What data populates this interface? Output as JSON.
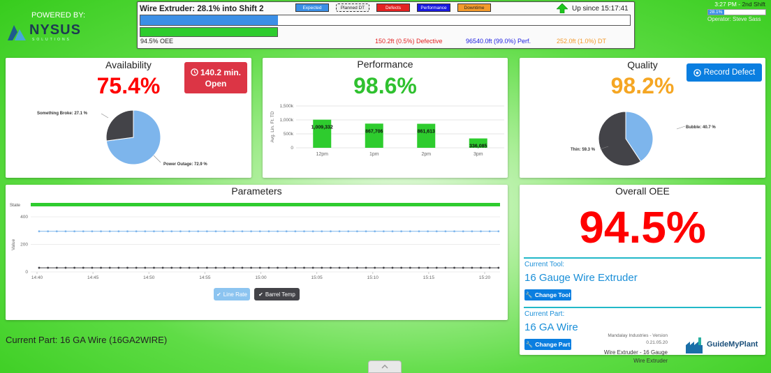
{
  "brand": {
    "powered_by": "POWERED BY:",
    "name": "NYSUS",
    "sub": "SOLUTIONS"
  },
  "header": {
    "title": "Wire Extruder: 28.1% into Shift 2",
    "legend": [
      {
        "label": "Expected",
        "bg": "#3b8fe6",
        "fg": "#ffffff"
      },
      {
        "label": "Planned DT",
        "bg": "#f0f0f0",
        "fg": "#222222"
      },
      {
        "label": "Defects",
        "bg": "#e32222",
        "fg": "#ffffff"
      },
      {
        "label": "Performance",
        "bg": "#1a1ae0",
        "fg": "#ffffff"
      },
      {
        "label": "Downtime",
        "bg": "#f39a2c",
        "fg": "#222222"
      }
    ],
    "uptime": "Up since 15:17:41",
    "expected_fraction": 0.281,
    "oee_fraction": 0.281,
    "oee_text": "94.5% OEE",
    "defective_text": "150.2ft (0.5%) Defective",
    "perf_text": "96540.0ft (99.0%) Perf.",
    "dt_text": "252.0ft (1.0%) DT"
  },
  "topright": {
    "time": "3:27 PM",
    "shift": "2nd Shift",
    "progress_text": "28.1%",
    "progress_fraction": 0.281,
    "operator": "Operator: Steve Sass"
  },
  "availability": {
    "title": "Availability",
    "value": "75.4%",
    "open_time": "140.2 min.",
    "open_label": "Open",
    "slices": [
      {
        "label": "Power Outage: 72.9 %",
        "value": 72.9,
        "color": "#7db5ec"
      },
      {
        "label": "Something Broke: 27.1 %",
        "value": 27.1,
        "color": "#434348"
      }
    ]
  },
  "performance": {
    "title": "Performance",
    "value": "98.6%",
    "chart_data": {
      "type": "bar",
      "categories": [
        "12pm",
        "1pm",
        "2pm",
        "3pm"
      ],
      "values": [
        1009332,
        867706,
        861613,
        336085
      ],
      "value_labels": [
        "1,009,332",
        "867,706",
        "861,613",
        "336,085"
      ],
      "ylabel": "Avg. Lin. Ft. TD",
      "yticks": [
        "0",
        "500k",
        "1,000k",
        "1,500k"
      ],
      "ylim": [
        0,
        1500000
      ],
      "color": "#2ecc2e"
    }
  },
  "quality": {
    "title": "Quality",
    "value": "98.2%",
    "record_label": "Record Defect",
    "slices": [
      {
        "label": "Bubble: 40.7 %",
        "value": 40.7,
        "color": "#7db5ec"
      },
      {
        "label": "Thin: 59.3 %",
        "value": 59.3,
        "color": "#434348"
      }
    ]
  },
  "parameters": {
    "title": "Parameters",
    "state_label": "State",
    "chart_data": {
      "type": "line",
      "ylabel": "Value",
      "yticks": [
        "0",
        "200",
        "400"
      ],
      "ylim": [
        0,
        400
      ],
      "x_ticks": [
        "14:40",
        "14:45",
        "14:50",
        "14:55",
        "15:00",
        "15:05",
        "15:10",
        "15:15",
        "15:20"
      ],
      "series": [
        {
          "name": "Line Rate",
          "value": 295,
          "color": "#7db5ec"
        },
        {
          "name": "Barrel Temp",
          "value": 30,
          "color": "#434348"
        }
      ]
    }
  },
  "overall": {
    "title": "Overall OEE",
    "value": "94.5%",
    "tool_label": "Current Tool:",
    "tool_name": "16 Gauge Wire Extruder",
    "change_tool": "Change Tool",
    "part_label": "Current Part:",
    "part_name": "16 GA Wire",
    "change_part": "Change Part",
    "footer_company": "Mandalay Industries - Version 0.21.05.20",
    "footer_machine": "Wire Extruder - 16 Gauge Wire Extruder",
    "guide_logo": "GuideMyPlant"
  },
  "current_part": "Current Part: 16 GA Wire (16GA2WIRE)",
  "collapse_icon": "chevron-up-icon",
  "accent": {
    "red": "#ff0000",
    "green": "#2fc12f",
    "orange": "#f5a623",
    "blue": "#0a7ee0"
  }
}
